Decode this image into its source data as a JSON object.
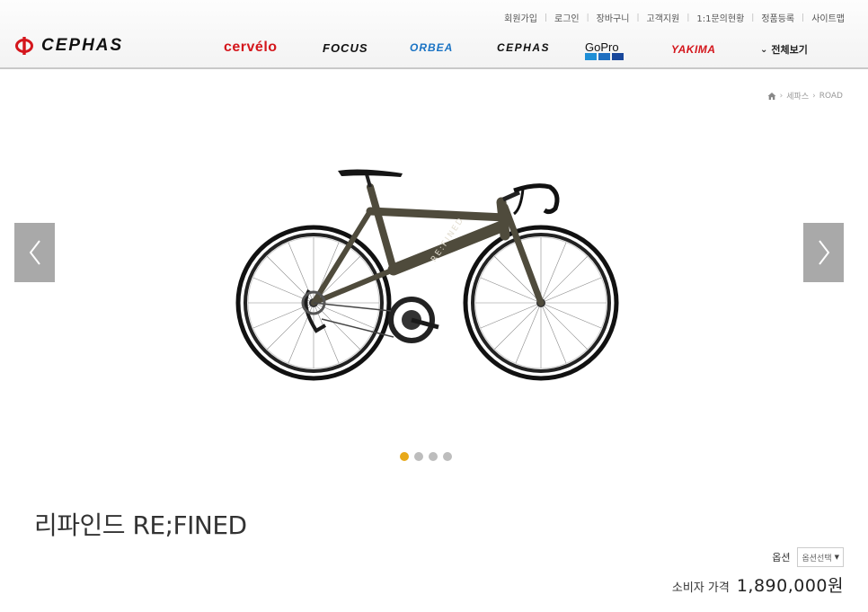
{
  "top_links": [
    "회원가입",
    "로그인",
    "장바구니",
    "고객지원",
    "1:1문의현황",
    "정품등록",
    "사이트맵"
  ],
  "logo": {
    "text": "CEPHAS",
    "color": "#d4161c"
  },
  "brands": {
    "cervelo": "cervélo",
    "focus": "FOCUS",
    "orbea": "ORBEA",
    "cephas": "CEPHAS",
    "gopro": "GoPro",
    "yakima": "YAKIMA"
  },
  "view_all": "전체보기",
  "breadcrumb": [
    "세파스",
    "ROAD"
  ],
  "slider": {
    "prev_icon": "chevron-left-icon",
    "next_icon": "chevron-right-icon",
    "slide_count": 4,
    "active_index": 0
  },
  "product": {
    "name": "리파인드 RE;FINED",
    "option_label": "옵션",
    "option_placeholder": "옵션선택",
    "price_label": "소비자 가격",
    "price": "1,890,000원",
    "frame_text": "RE:FINED"
  },
  "colors": {
    "accent": "#e8a91a",
    "brand_red": "#d4161c",
    "orbea_blue": "#1a73c4",
    "gopro_blue": [
      "#1f8fd6",
      "#1f6fc0",
      "#18479b"
    ],
    "frame": "#4f4b3c"
  }
}
